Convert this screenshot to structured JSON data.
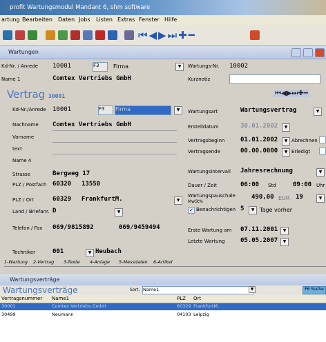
{
  "app": {
    "title": "profit Wartungsmodul  Mandant 6, shm software"
  },
  "menu": [
    "artung",
    "Bearbeiten",
    "Daten",
    "Jobs",
    "Listen",
    "Extras",
    "Fenster",
    "Hilfe"
  ],
  "window1": {
    "title": "Wartungen"
  },
  "top": {
    "kdnr_label": "Kd-Nr. / Anrede",
    "kdnr_value": "10001",
    "f3": "F3",
    "firma": "Firma",
    "name1_label": "Name 1",
    "name1_value": "Comtex Vertriebs GmbH",
    "wartnr_label": "Wartungs-Nr.",
    "wartnr_value": "10002",
    "kurznotiz_label": "Kurznotiz"
  },
  "vertrag": {
    "title": "Vertrag",
    "number": "30001"
  },
  "form": {
    "kdnr_label": "Kd-Nr./Anrede",
    "kdnr_value": "10001",
    "f3": "F3",
    "firma": "Firma",
    "nachname_label": "Nachname",
    "nachname_value": "Comtex Vertriebs GmbH",
    "vorname_label": "Vorname",
    "text_label": "text",
    "name4_label": "Name 4",
    "strasse_label": "Strasse",
    "strasse_value": "Bergweg 17",
    "plzpf_label": "PLZ / Postfach",
    "plz1": "60320",
    "pf": "13550",
    "plzort_label": "PLZ / Ort",
    "plz2": "60329",
    "ort": "FrankfurtM.",
    "land_label": "Land / Briefanr.",
    "land": "D",
    "tel_label": "Telefon / Fax",
    "tel": "069/9815892",
    "fax": "069/9459494",
    "techniker_label": "Techniker",
    "tech_nr": "001",
    "tech_name": "Heubach"
  },
  "right": {
    "wartungsart_label": "Wartungsart",
    "wartungsart": "Wartungsvertrag",
    "erstell_label": "Erstelldatum",
    "erstell": "30.01.2002",
    "beginn_label": "Vertragsbeginn",
    "beginn": "01.01.2002",
    "abrechnen": "Abrechnen",
    "ende_label": "Vertragsende",
    "ende": "00.00.0000",
    "erledigt": "Erledigt",
    "intervall_label": "Wartungsintervall",
    "intervall": "Jahresrechnung",
    "dauer_label": "Dauer / Zeit",
    "dauer": "06:00",
    "std": "Std",
    "zeit": "09:00",
    "uhr": "Uhr",
    "pausch_label": "Wartungspauschale",
    "mwst": "MwSt%",
    "pausch": "490,00",
    "eur": "EUR",
    "mwst_val": "19",
    "benach_label": "Benachrichtigen",
    "benach_val": "5",
    "tage": "Tage vorher",
    "erste_label": "Erste Wartung am",
    "erste": "07.11.2001",
    "letzte_label": "Letzte Wartung",
    "letzte": "05.05.2007"
  },
  "tabs": [
    "1-Wartung",
    "2-Vertrag",
    "3-Texte",
    "4-Anlage",
    "5-Messdaten",
    "6-Artikel"
  ],
  "window2": {
    "title": "Wartungsverträge",
    "heading": "Wartungsverträge",
    "sort_label": "Sort.",
    "sort_value": "Name1",
    "btn": "F6 Suche"
  },
  "table": {
    "headers": [
      "Vertragsnummer",
      "Name1",
      "PLZ",
      "Ort"
    ],
    "rows": [
      [
        "30001",
        "Comtex Vertriebs GmbH",
        "60329",
        "FrankfurtM."
      ],
      [
        "30499",
        "Neumann",
        "04103",
        "Leipzig"
      ]
    ]
  },
  "colors": {
    "accent": "#316ac5",
    "heading": "#4a74b8",
    "title": "#3a6ea5"
  }
}
